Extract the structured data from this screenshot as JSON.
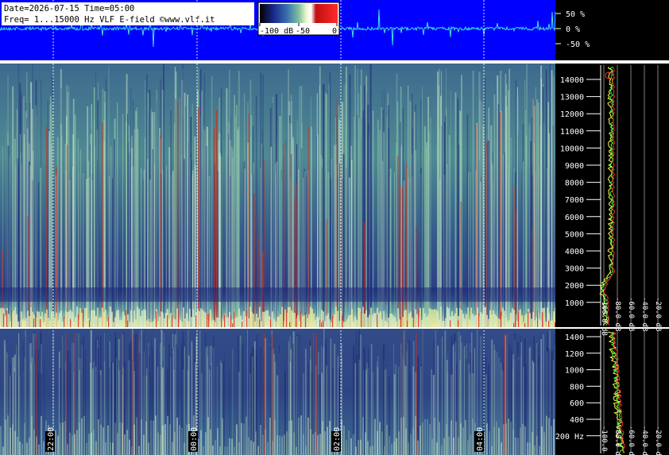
{
  "header": {
    "date_line": "Date=2026-07-15 Time=05:00",
    "freq_line": "Freq= 1...15000 Hz   VLF E-field ©www.vlf.it"
  },
  "colorbar": {
    "labels": [
      "-100 dB",
      "-50",
      "0"
    ],
    "colors": [
      "#000000",
      "#1a2a8c",
      "#3a6fb0",
      "#6fb0a0",
      "#e8f0c0",
      "#ffffff",
      "#c00000",
      "#ff2020"
    ]
  },
  "waveform": {
    "percent_labels": [
      "50 %",
      "0 %",
      "-50 %"
    ],
    "background": "#0000ff",
    "trace_color": "#40e0e0"
  },
  "upper_spectrogram": {
    "freq_labels": [
      "14000",
      "13000",
      "12000",
      "11000",
      "10000",
      "9000",
      "8000",
      "7000",
      "6000",
      "5000",
      "4000",
      "3000",
      "2000",
      "1000"
    ],
    "db_labels": [
      "-100.0 dB",
      "-80.0 dB",
      "-60.0 dB",
      "-40.0 dB",
      "-20.0 dB"
    ]
  },
  "lower_spectrogram": {
    "freq_labels": [
      "1400",
      "1200",
      "1000",
      "800",
      "600",
      "400",
      "200 Hz"
    ],
    "db_labels": [
      "-100.0 dB",
      "-80.0 dB",
      "-60.0 dB",
      "-40.0 dB",
      "-20.0 dB"
    ]
  },
  "time_markers": [
    "22:00",
    "00:00",
    "02:00",
    "04:00"
  ]
}
